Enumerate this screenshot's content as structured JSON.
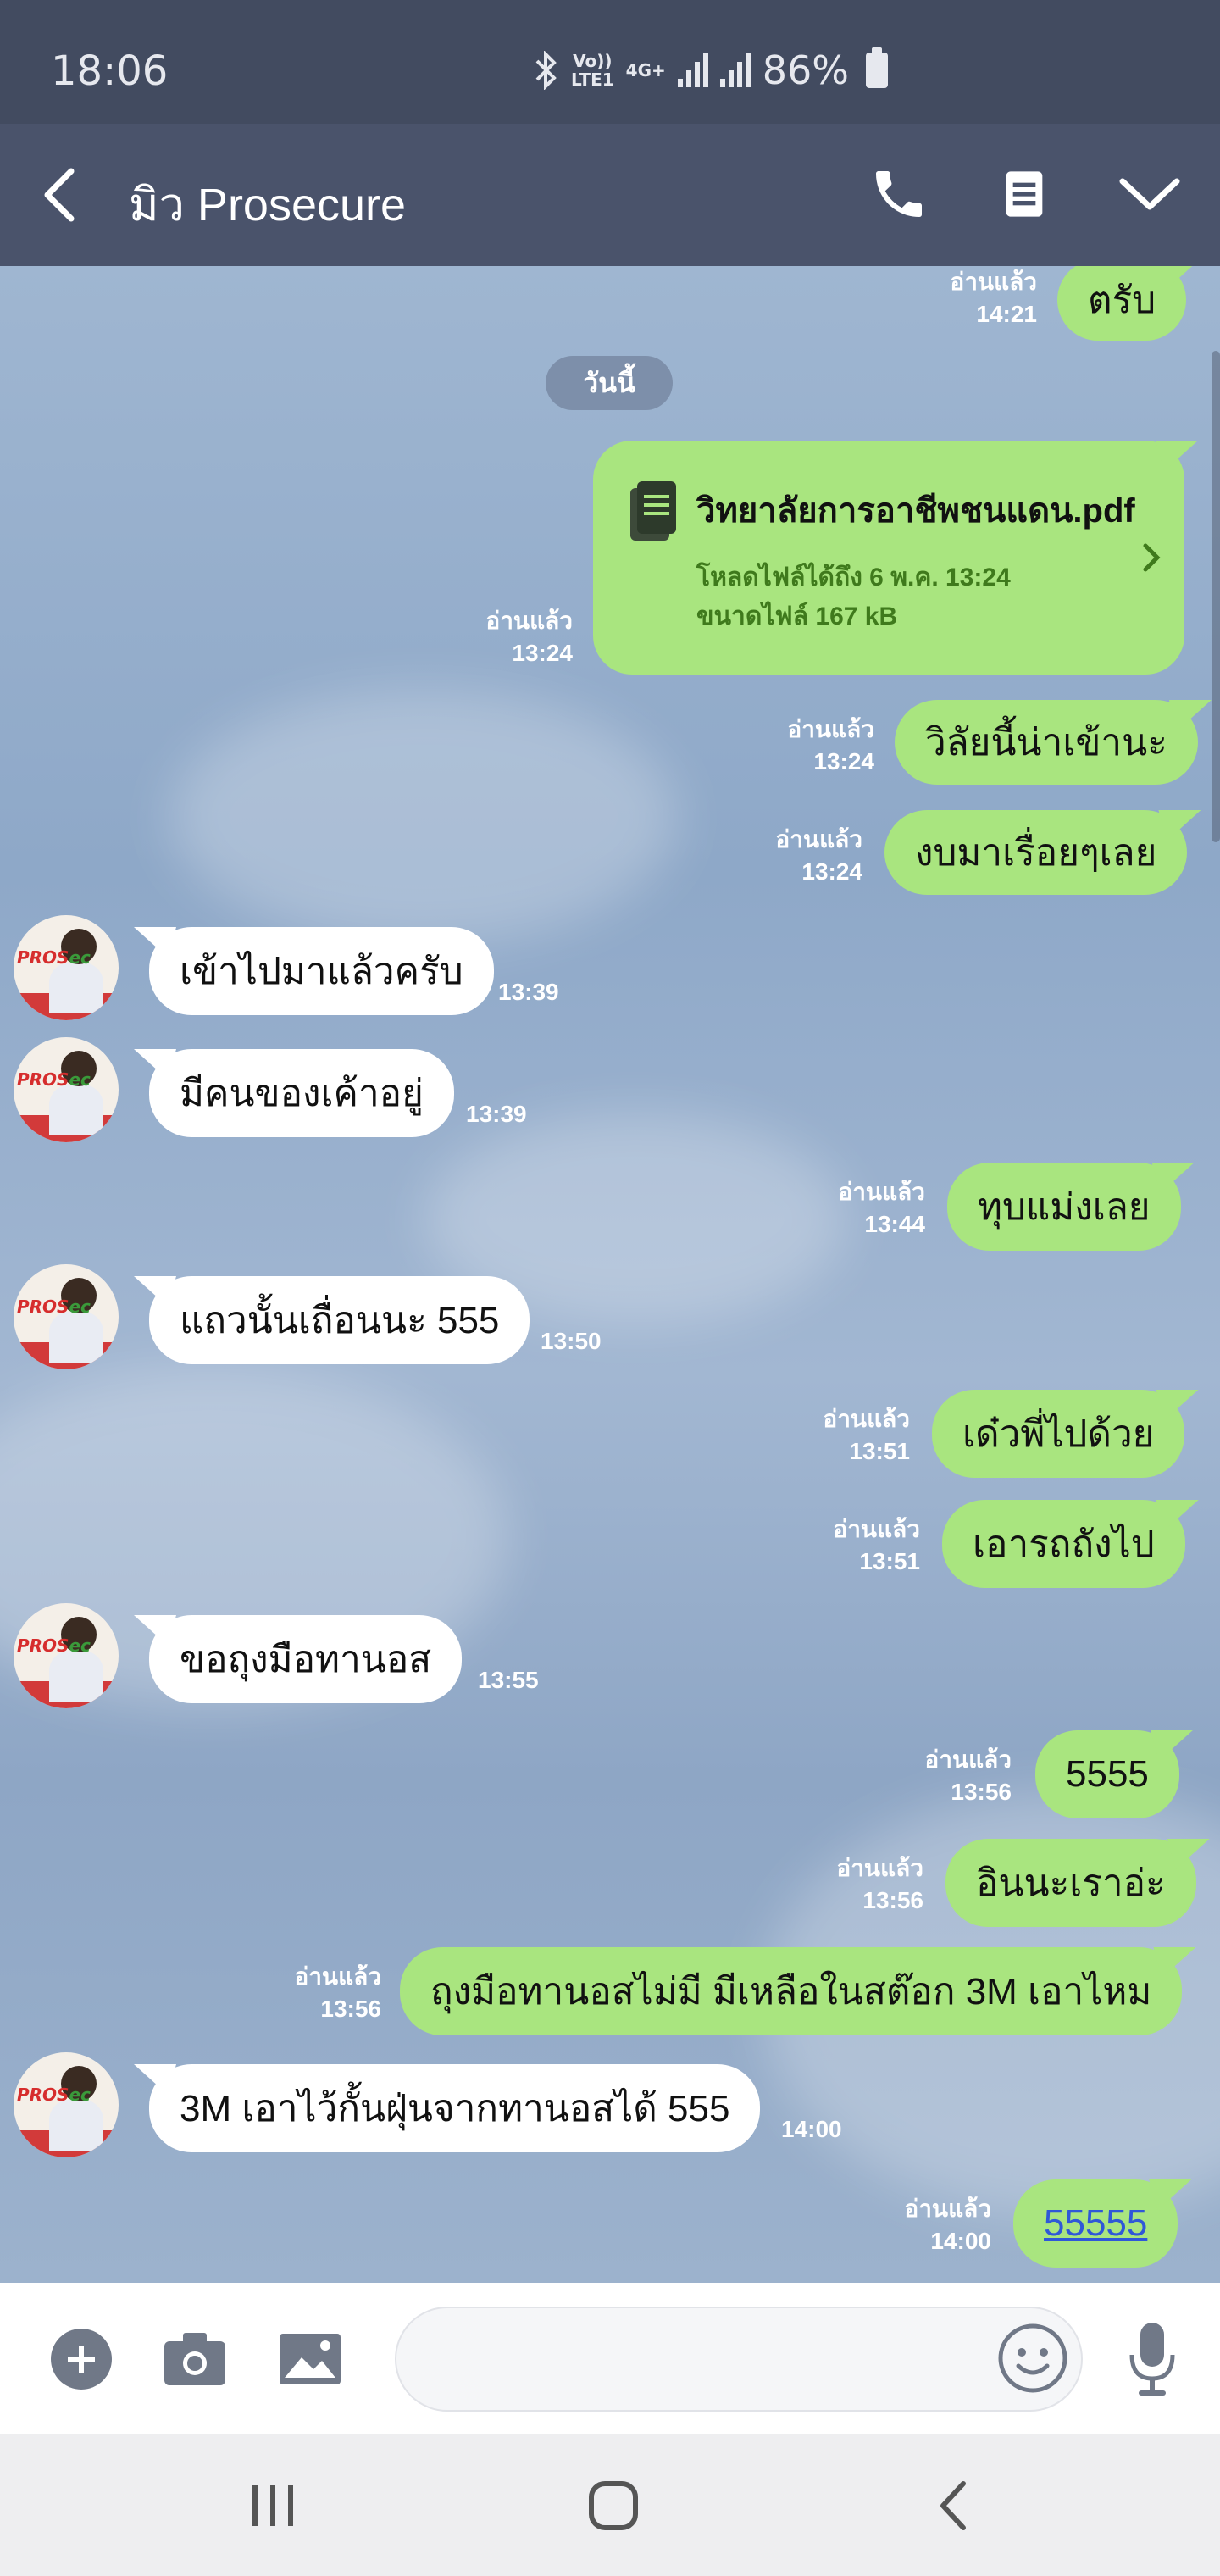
{
  "status": {
    "time": "18:06",
    "volte": "Vo))",
    "lte": "LTE1",
    "net": "4G+",
    "battery": "86%"
  },
  "header": {
    "title": "มิว Prosecure"
  },
  "chat": {
    "top_message": {
      "text": "ตรับ",
      "read": "อ่านแล้ว",
      "time": "14:21"
    },
    "date_divider": "วันนี้",
    "file": {
      "name": "วิทยาลัยการอาชีพชนแดน.pdf",
      "expiry": "โหลดไฟล์ได้ถึง 6 พ.ค. 13:24",
      "size": "ขนาดไฟล์ 167 kB",
      "read": "อ่านแล้ว",
      "time": "13:24"
    },
    "messages": [
      {
        "dir": "out",
        "text": "วิลัยนี้น่าเข้านะ",
        "read": "อ่านแล้ว",
        "time": "13:24"
      },
      {
        "dir": "out",
        "text": "งบมาเรื่อยๆเลย",
        "read": "อ่านแล้ว",
        "time": "13:24"
      },
      {
        "dir": "in",
        "text": "เข้าไปมาแล้วครับ",
        "time": "13:39"
      },
      {
        "dir": "in",
        "text": "มีคนของเค้าอยู่",
        "time": "13:39"
      },
      {
        "dir": "out",
        "text": "ทุบแม่งเลย",
        "read": "อ่านแล้ว",
        "time": "13:44"
      },
      {
        "dir": "in",
        "text": "แถวนั้นเถื่อนนะ 555",
        "time": "13:50"
      },
      {
        "dir": "out",
        "text": "เด๋วพี่ไปด้วย",
        "read": "อ่านแล้ว",
        "time": "13:51"
      },
      {
        "dir": "out",
        "text": "เอารถถังไป",
        "read": "อ่านแล้ว",
        "time": "13:51"
      },
      {
        "dir": "in",
        "text": "ขอถุงมือทานอส",
        "time": "13:55"
      },
      {
        "dir": "out",
        "text": "5555",
        "read": "อ่านแล้ว",
        "time": "13:56"
      },
      {
        "dir": "out",
        "text": "อินนะเราอ่ะ",
        "read": "อ่านแล้ว",
        "time": "13:56"
      },
      {
        "dir": "out",
        "text": "ถุงมือทานอสไม่มี มีเหลือในสต๊อก 3M เอาไหม",
        "read": "อ่านแล้ว",
        "time": "13:56"
      },
      {
        "dir": "in",
        "text": "3M เอาไว้กั้นฝุ่นจากทานอสได้ 555",
        "time": "14:00"
      },
      {
        "dir": "out",
        "text": "55555",
        "read": "อ่านแล้ว",
        "time": "14:00"
      }
    ]
  },
  "input": {
    "placeholder": ""
  },
  "colors": {
    "outgoing": "#a9e57f",
    "incoming": "#ffffff",
    "header": "#4a536b",
    "status_bar": "#424b60"
  }
}
